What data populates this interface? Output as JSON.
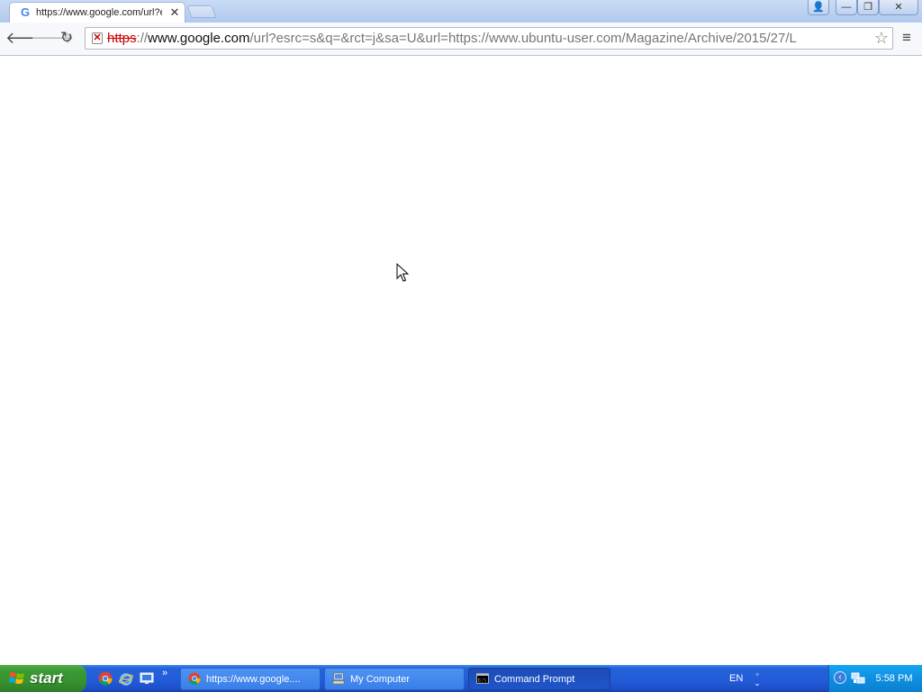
{
  "browser": {
    "tab": {
      "title": "https://www.google.com/url?esrc=s&q=&rct=j&sa=U&url=https://www.ubuntu-user.com",
      "favicon": "G",
      "close_glyph": "✕"
    },
    "omnibox": {
      "url_scheme": "https",
      "url_after_scheme": "://",
      "url_host": "www.google.com",
      "url_rest": "/url?esrc=s&q=&rct=j&sa=U&url=https://www.ubuntu-user.com/Magazine/Archive/2015/27/L",
      "security_glyph": "✕"
    },
    "icons": {
      "back": "back-arrow-icon",
      "forward": "forward-arrow-icon",
      "reload": "reload-icon",
      "star": "star-icon",
      "menu": "hamburger-menu-icon"
    },
    "glyphs": {
      "back": "🡐",
      "forward": "🡒",
      "reload": "↻",
      "star": "☆",
      "menu": "≡",
      "minimize": "—",
      "maximize": "❐",
      "close": "✕",
      "profile": "👤"
    }
  },
  "taskbar": {
    "start_label": "start",
    "quick_launch_more": "»",
    "tasks": [
      {
        "label": "https://www.google....",
        "icon": "chrome-icon",
        "active": false
      },
      {
        "label": "My Computer",
        "icon": "my-computer-icon",
        "active": false
      },
      {
        "label": "Command Prompt",
        "icon": "command-prompt-icon",
        "active": true
      }
    ],
    "language": "EN",
    "tray_expand_glyph": "‹",
    "clock": "5:58 PM"
  },
  "colors": {
    "accent": "#245edb",
    "start_green": "#3c9a37",
    "insecure_red": "#cc0000"
  }
}
